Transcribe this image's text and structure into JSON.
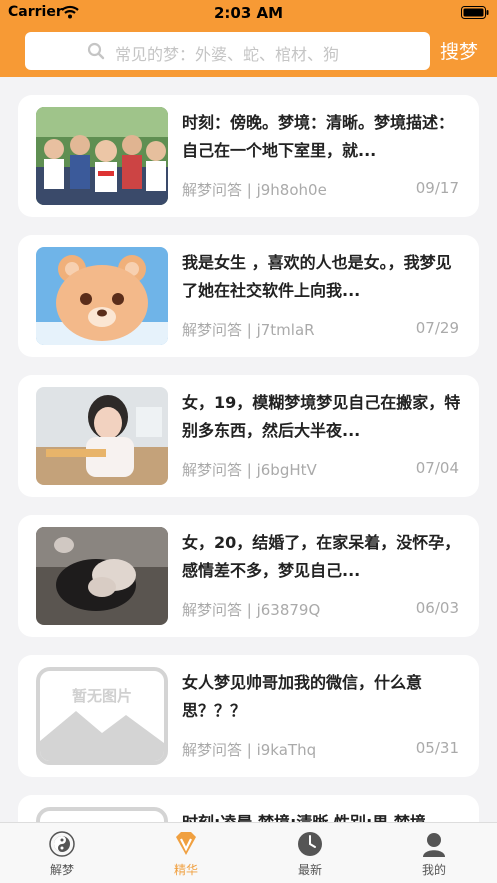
{
  "status_bar": {
    "carrier": "Carrier",
    "time": "2:03 AM"
  },
  "search": {
    "placeholder": "常见的梦：外婆、蛇、棺材、狗",
    "button_label": "搜梦"
  },
  "feed": [
    {
      "title": "时刻：傍晚。梦境：清晰。梦境描述：自己在一个地下室里，就...",
      "source": "解梦问答 | j9h8oh0e",
      "date": "09/17",
      "thumb": "photo-kids-group"
    },
    {
      "title": "我是女生 ，喜欢的人也是女。，我梦见了她在社交软件上向我...",
      "source": "解梦问答 | j7tmlaR",
      "date": "07/29",
      "thumb": "cartoon-bear"
    },
    {
      "title": "女，19，模糊梦境梦见自己在搬家，特别多东西，然后大半夜...",
      "source": "解梦问答 | j6bgHtV",
      "date": "07/04",
      "thumb": "photo-girl"
    },
    {
      "title": "女，20，结婚了，在家呆着，没怀孕，感情差不多，梦见自己...",
      "source": "解梦问答 | j63879Q",
      "date": "06/03",
      "thumb": "photo-hands"
    },
    {
      "title": "女人梦见帅哥加我的微信，什么意思？？？",
      "source": "解梦问答 | i9kaThq",
      "date": "05/31",
      "thumb": "placeholder-no-image",
      "thumb_text": "暂无图片"
    },
    {
      "title": "时刻:凌晨 梦境:清晰 性别:男 梦境",
      "source": "",
      "date": "",
      "thumb": "placeholder-no-image",
      "thumb_text": ""
    }
  ],
  "tabs": [
    {
      "label": "解梦",
      "icon": "yin-yang-icon",
      "active": false
    },
    {
      "label": "精华",
      "icon": "diamond-v-icon",
      "active": true
    },
    {
      "label": "最新",
      "icon": "clock-icon",
      "active": false
    },
    {
      "label": "我的",
      "icon": "user-icon",
      "active": false
    }
  ],
  "colors": {
    "accent": "#f79a35",
    "tab_active": "#f0a040"
  }
}
